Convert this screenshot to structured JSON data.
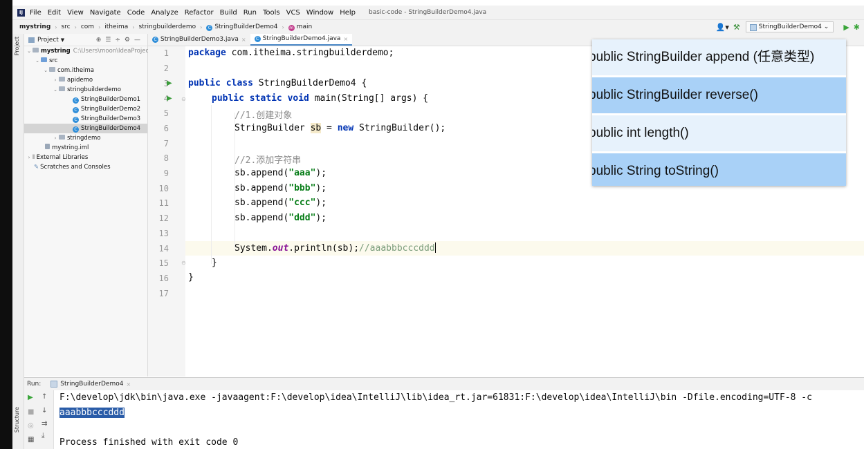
{
  "menu": {
    "items": [
      "File",
      "Edit",
      "View",
      "Navigate",
      "Code",
      "Analyze",
      "Refactor",
      "Build",
      "Run",
      "Tools",
      "VCS",
      "Window",
      "Help"
    ],
    "window_title": "basic-code - StringBuilderDemo4.java"
  },
  "breadcrumb": {
    "project": "mystring",
    "parts": [
      "src",
      "com",
      "itheima",
      "stringbuilderdemo",
      "StringBuilderDemo4",
      "main"
    ]
  },
  "run_config": "StringBuilderDemo4",
  "left_stripe": {
    "project_tab": "Project",
    "structure_tab": "Structure"
  },
  "project_panel": {
    "header": "Project",
    "tree": [
      {
        "label": "mystring",
        "hint": "C:\\Users\\moon\\IdeaProjec"
      },
      {
        "label": "src"
      },
      {
        "label": "com.itheima"
      },
      {
        "label": "apidemo"
      },
      {
        "label": "stringbuilderdemo"
      },
      {
        "label": "StringBuilderDemo1"
      },
      {
        "label": "StringBuilderDemo2"
      },
      {
        "label": "StringBuilderDemo3"
      },
      {
        "label": "StringBuilderDemo4"
      },
      {
        "label": "stringdemo"
      },
      {
        "label": "mystring.iml"
      },
      {
        "label": "External Libraries"
      },
      {
        "label": "Scratches and Consoles"
      }
    ]
  },
  "editor": {
    "tabs": [
      "StringBuilderDemo3.java",
      "StringBuilderDemo4.java"
    ],
    "line_numbers": [
      "1",
      "2",
      "3",
      "4",
      "5",
      "6",
      "7",
      "8",
      "9",
      "10",
      "11",
      "12",
      "13",
      "14",
      "15",
      "16",
      "17"
    ],
    "code": {
      "l1_kw": "package",
      "l1_rest": " com.itheima.stringbuilderdemo;",
      "l3_kw": "public class",
      "l3_rest": " StringBuilderDemo4 {",
      "l4_kw": "public static void",
      "l4_rest": " main(String[] args) {",
      "l5_cmt": "//1.创建对象",
      "l6_a": "StringBuilder ",
      "l6_var": "sb",
      "l6_b": " = ",
      "l6_kw": "new",
      "l6_c": " StringBuilder();",
      "l8_cmt": "//2.添加字符串",
      "l9_a": "sb.append(",
      "l9_s": "\"aaa\"",
      "l9_b": ");",
      "l10_a": "sb.append(",
      "l10_s": "\"bbb\"",
      "l10_b": ");",
      "l11_a": "sb.append(",
      "l11_s": "\"ccc\"",
      "l11_b": ");",
      "l12_a": "sb.append(",
      "l12_s": "\"ddd\"",
      "l12_b": ");",
      "l14_a": "System.",
      "l14_it": "out",
      "l14_b": ".println(sb);",
      "l14_cmt": "//aaabbbcccddd",
      "l15": "}",
      "l16": "}"
    }
  },
  "popup": {
    "items": [
      "public StringBuilder append (任意类型)",
      "public StringBuilder reverse()",
      "public int length()",
      "public String toString()"
    ]
  },
  "run_panel": {
    "label": "Run:",
    "tab": "StringBuilderDemo4",
    "lines": [
      "F:\\develop\\jdk\\bin\\java.exe -javaagent:F:\\develop\\idea\\IntelliJ\\lib\\idea_rt.jar=61831:F:\\develop\\idea\\IntelliJ\\bin -Dfile.encoding=UTF-8 -c",
      "aaabbbcccddd",
      "Process finished with exit code 0"
    ]
  }
}
